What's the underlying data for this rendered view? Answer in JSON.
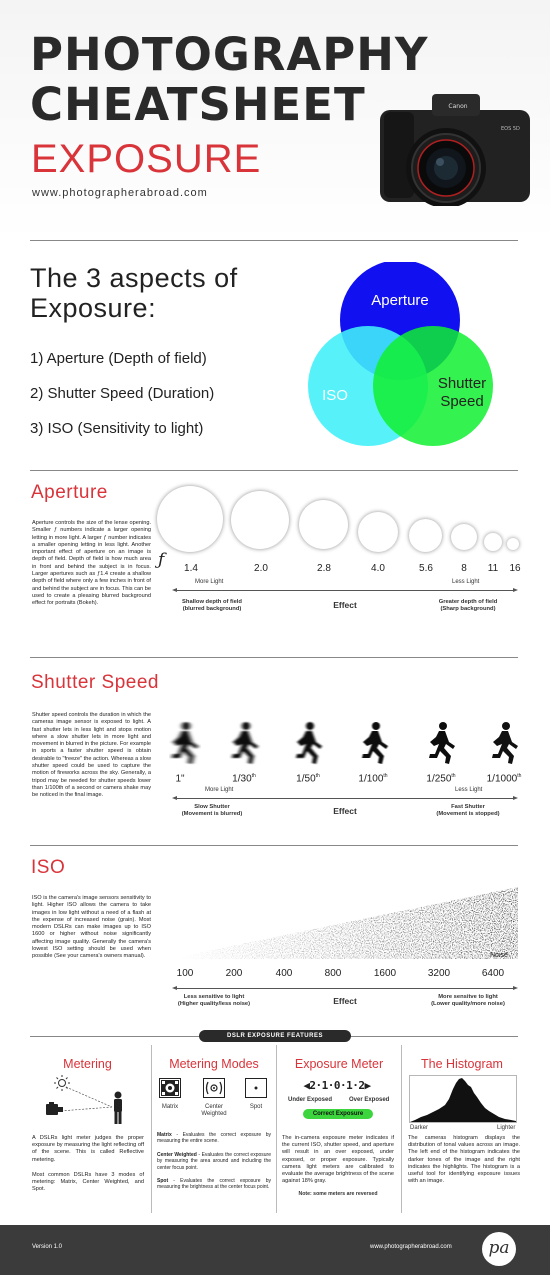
{
  "header": {
    "title_line1": "PHOTOGRAPHY",
    "title_line2": "CHEATSHEET",
    "subtitle": "EXPOSURE",
    "url": "www.photographerabroad.com",
    "camera_brand": "Canon",
    "camera_model": "EOS 5D"
  },
  "aspects": {
    "heading_line1": "The 3 aspects of",
    "heading_line2": "Exposure:",
    "items": [
      "1) Aperture (Depth of field)",
      "2) Shutter Speed (Duration)",
      "3) ISO (Sensitivity to light)"
    ],
    "venn": {
      "aperture": "Aperture",
      "iso": "ISO",
      "shutter_line1": "Shutter",
      "shutter_line2": "Speed"
    },
    "colors": {
      "aperture": "#1010f0",
      "iso": "#40f0f8",
      "shutter": "#10f030"
    }
  },
  "aperture": {
    "title": "Aperture",
    "text": "Aperture controls the size of the lense opening. Smaller ƒ numbers indicate a larger opening letting in more light. A larger ƒ number indicates a smaller opening letting in less light. Another important effect of aperture on an image is depth of field. Depth of field is how much area in front and behind the subject is in focus. Larger apertures such as ƒ1.4 create a shallow depth of field where only a few inches in front of and behind the subject are in focus. This can be used to create a pleasing blurred background effect for portraits (Bokeh).",
    "f_symbol": "ƒ",
    "stops": [
      "1.4",
      "2.0",
      "2.8",
      "4.0",
      "5.6",
      "8",
      "11",
      "16"
    ],
    "more": "More Light",
    "less": "Less Light",
    "left_end_line1": "Shallow depth of field",
    "left_end_line2": "(blurred background)",
    "effect": "Effect",
    "right_end_line1": "Greater depth of field",
    "right_end_line2": "(Sharp background)"
  },
  "shutter": {
    "title": "Shutter Speed",
    "text": "Shutter speed controls the duration in which the cameras image sensor is exposed to light. A fast shutter lets in less light and stops motion where a slow shutter lets in more light and movement in blurred in the picture. For example in sports a faster shutter speed is obtain desirable to \"freeze\" the action. Whereas a slow shutter speed could be used to capture the motion of fireworks across the sky. Generally, a tripod may be needed for shutter speeds lower than 1/100th of a second or camera shake may be noticed in the final image.",
    "speeds": [
      "1\"",
      "1/30",
      "1/50",
      "1/100",
      "1/250",
      "1/1000"
    ],
    "suffixes": [
      "",
      "th",
      "th",
      "th",
      "th",
      "th"
    ],
    "more": "More Light",
    "less": "Less Light",
    "left_end_line1": "Slow Shutter",
    "left_end_line2": "(Movement is blurred)",
    "effect": "Effect",
    "right_end_line1": "Fast Shutter",
    "right_end_line2": "(Movement is stopped)"
  },
  "iso": {
    "title": "ISO",
    "text": "ISO is the camera's image sensors sensitivity to light. Higher ISO allows the camera to take images in low light without a need of a flash at the expense of increased noise (grain). Most modern DSLRs can make images up to ISO 1600 or higher without noise significantly affecting image quality. Generally the camera's lowest ISO setting should be used when possible (See your camera's owners manual).",
    "noise": "Noise",
    "values": [
      "100",
      "200",
      "400",
      "800",
      "1600",
      "3200",
      "6400"
    ],
    "left_end_line1": "Less sensitive to light",
    "left_end_line2": "(Higher quality/less noise)",
    "effect": "Effect",
    "right_end_line1": "More sensitve to light",
    "right_end_line2": "(Lower quality/more noise)"
  },
  "features": {
    "banner": "DSLR EXPOSURE FEATURES",
    "metering": {
      "title": "Metering",
      "text1": "A DSLRs light meter judges the proper exposure by measuring the light reflecting off of the scene. This is called Reflective metering.",
      "text2": "Most common DSLRs have 3 modes of metering: Matrix, Center Weighted, and Spot."
    },
    "modes": {
      "title": "Metering Modes",
      "labels": [
        "Matrix",
        "Center Weighted",
        "Spot"
      ],
      "matrix_term": "Matrix",
      "matrix_desc": " - Evaluates the correct exposure by measuring the entire scene.",
      "center_term": "Center Weighted",
      "center_desc": " - Evaluates the correct exposure by measuring the area around and including the center focus point.",
      "spot_term": "Spot",
      "spot_desc": " - Evaluates the correct exposure by measuring the brightness at the center focus point."
    },
    "meter": {
      "title": "Exposure Meter",
      "scale": "◀2·1·0·1·2▶",
      "under": "Under Exposed",
      "over": "Over Exposed",
      "correct": "Correct Exposure",
      "text": "The in-camera exposure meter indicates if the current ISO, shutter speed, and aperture will result in an over exposed, under exposed, or proper exposure. Typically camera light meters are calibrated to evaluate the average brightness of the scene against 18% gray.",
      "note": "Note: some meters are reversed"
    },
    "histogram": {
      "title": "The Histogram",
      "darker": "Darker",
      "lighter": "Lighter",
      "text": "The cameras histogram displays the distribution of tonal values across an image. The left end of the histogram indicates the darker tones of the image and the right indicates the highlights. The histogram is a useful tool for identifying exposure issues with an image."
    }
  },
  "footer": {
    "version": "Version 1.0",
    "url": "www.photographerabroad.com",
    "logo": "pa"
  }
}
